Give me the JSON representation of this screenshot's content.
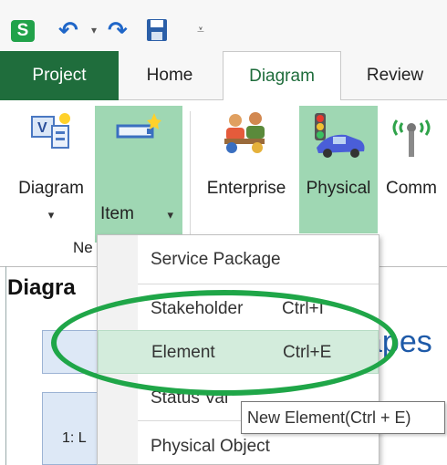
{
  "quick_access": {
    "app_icon": "S",
    "icons": [
      "app-icon",
      "undo-icon",
      "dropdown-arrow-icon",
      "redo-icon",
      "save-icon",
      "customize-icon"
    ]
  },
  "tabs": [
    {
      "label": "Project"
    },
    {
      "label": "Home"
    },
    {
      "label": "Diagram"
    },
    {
      "label": "Review"
    }
  ],
  "ribbon": {
    "diagram_label": "Diagram",
    "item_label": "Item",
    "enterprise_label": "Enterprise",
    "physical_label": "Physical",
    "comm_label": "Comm",
    "group_label": "Ne"
  },
  "pane": {
    "title": "Diagra",
    "box_label": "1: L",
    "bg_text": "apes"
  },
  "menu": {
    "items": [
      {
        "label": "Service Package",
        "shortcut": ""
      },
      {
        "label": "Stakeholder",
        "shortcut": "Ctrl+I"
      },
      {
        "label": "Element",
        "shortcut": "Ctrl+E"
      },
      {
        "label": "Status Val",
        "shortcut": ""
      },
      {
        "label": "Physical Object",
        "shortcut": ""
      }
    ]
  },
  "tooltip": "New Element(Ctrl + E)",
  "colors": {
    "accent_green": "#1f6d3c",
    "highlight_green": "#9fd7b3",
    "annotation_green": "#1fa648"
  }
}
